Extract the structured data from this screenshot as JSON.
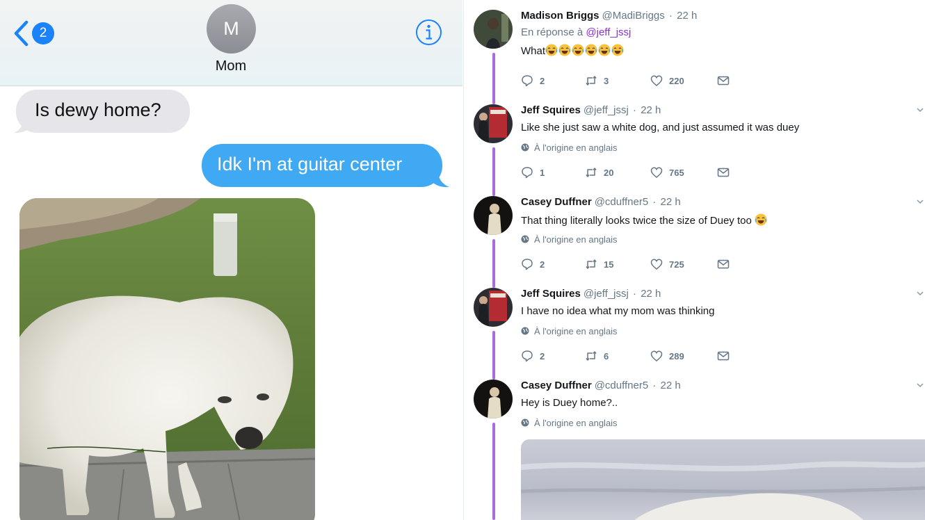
{
  "imessage": {
    "back_badge": "2",
    "contact_initial": "M",
    "contact_name": "Mom",
    "messages": [
      {
        "direction": "incoming",
        "text": "Is dewy home?"
      },
      {
        "direction": "outgoing",
        "text": "Idk I'm at guitar center"
      }
    ],
    "photo_icon": "white-dog-photo"
  },
  "twitter": {
    "accent_color": "#ab6cde",
    "tweets": [
      {
        "name": "Madison Briggs",
        "handle": "@MadiBriggs",
        "time": "22 h",
        "reply_prefix": "En réponse à ",
        "reply_mention": "@jeff_jssj",
        "text": "What",
        "emoji_count": 6,
        "replies": "2",
        "retweets": "3",
        "likes": "220"
      },
      {
        "name": "Jeff Squires",
        "handle": "@jeff_jssj",
        "time": "22 h",
        "text": "Like she just saw a white dog, and just assumed it was duey",
        "translate": "À l'origine en anglais",
        "replies": "1",
        "retweets": "20",
        "likes": "765"
      },
      {
        "name": "Casey Duffner",
        "handle": "@cduffner5",
        "time": "22 h",
        "text": "That thing literally looks twice the size of Duey too",
        "translate": "À l'origine en anglais",
        "replies": "2",
        "retweets": "15",
        "likes": "725"
      },
      {
        "name": "Jeff Squires",
        "handle": "@jeff_jssj",
        "time": "22 h",
        "text": "I have no idea what my mom was thinking",
        "translate": "À l'origine en anglais",
        "replies": "2",
        "retweets": "6",
        "likes": "289"
      },
      {
        "name": "Casey Duffner",
        "handle": "@cduffner5",
        "time": "22 h",
        "text": "Hey is Duey home?..",
        "translate": "À l'origine en anglais"
      }
    ]
  }
}
